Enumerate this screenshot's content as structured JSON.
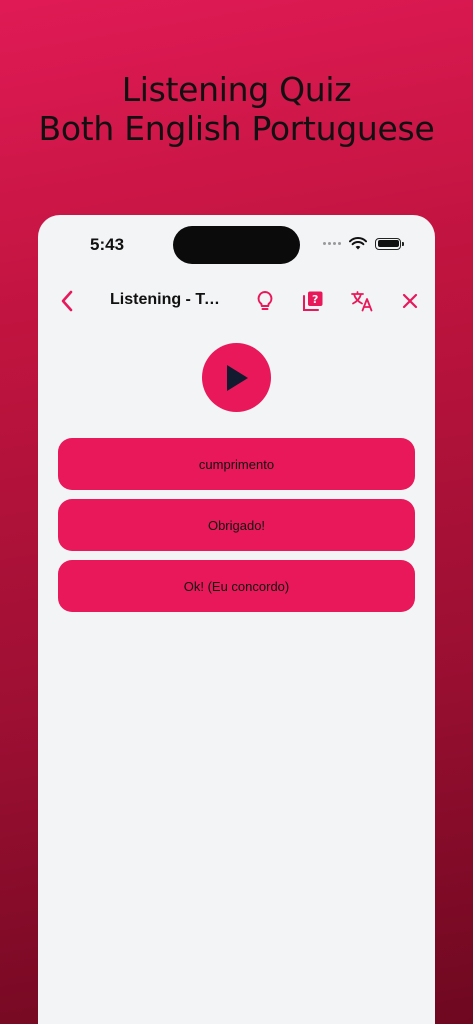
{
  "promo": {
    "line1": "Listening Quiz",
    "line2": "Both English Portuguese"
  },
  "status_bar": {
    "time": "5:43",
    "icons": [
      "signal-dots-icon",
      "wifi-icon",
      "battery-icon"
    ]
  },
  "nav": {
    "title": "Listening - Topic",
    "icons": [
      "chevron-left-icon",
      "lightbulb-icon",
      "question-cards-icon",
      "translate-icon",
      "close-icon"
    ]
  },
  "quiz": {
    "options": [
      {
        "label": "cumprimento"
      },
      {
        "label": "Obrigado!"
      },
      {
        "label": "Ok! (Eu concordo)"
      }
    ]
  },
  "colors": {
    "accent": "#e8185a",
    "background": "#f3f4f6",
    "play_icon": "#111a2e"
  }
}
